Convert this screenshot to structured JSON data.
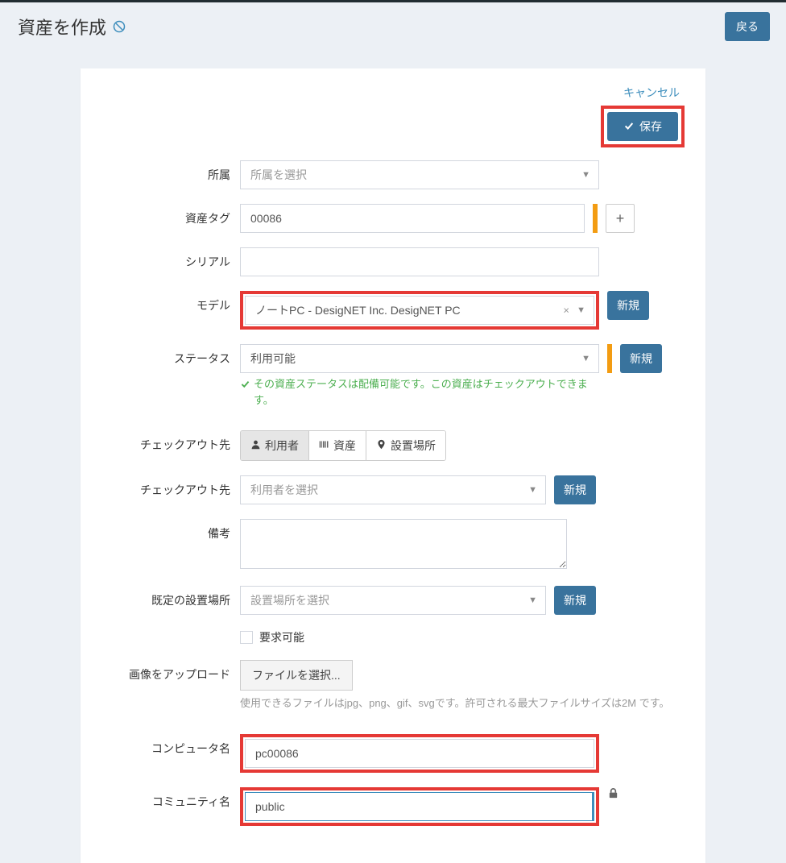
{
  "header": {
    "title": "資産を作成",
    "back_label": "戻る"
  },
  "actions": {
    "cancel_label": "キャンセル",
    "save_label": "保存"
  },
  "form": {
    "affiliation": {
      "label": "所属",
      "placeholder": "所属を選択"
    },
    "asset_tag": {
      "label": "資産タグ",
      "value": "00086"
    },
    "serial": {
      "label": "シリアル",
      "value": ""
    },
    "model": {
      "label": "モデル",
      "value": "ノートPC - DesigNET Inc. DesigNET PC",
      "new_label": "新規"
    },
    "status": {
      "label": "ステータス",
      "value": "利用可能",
      "new_label": "新規",
      "help_text": "その資産ステータスは配備可能です。この資産はチェックアウトできます。"
    },
    "checkout_to": {
      "label": "チェックアウト先",
      "options": {
        "user": "利用者",
        "asset": "資産",
        "location": "設置場所"
      }
    },
    "checkout_to_select": {
      "label": "チェックアウト先",
      "placeholder": "利用者を選択",
      "new_label": "新規"
    },
    "notes": {
      "label": "備考",
      "value": ""
    },
    "default_location": {
      "label": "既定の設置場所",
      "placeholder": "設置場所を選択",
      "new_label": "新規"
    },
    "requestable": {
      "label": "要求可能"
    },
    "image_upload": {
      "label": "画像をアップロード",
      "button_label": "ファイルを選択...",
      "help_text": "使用できるファイルはjpg、png、gif、svgです。許可される最大ファイルサイズは2M です。"
    },
    "computer_name": {
      "label": "コンピュータ名",
      "value": "pc00086"
    },
    "community_name": {
      "label": "コミュニティ名",
      "value": "public"
    }
  }
}
